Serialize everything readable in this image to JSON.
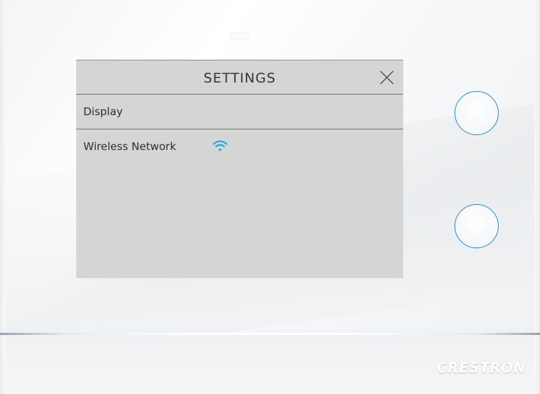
{
  "screen": {
    "title": "SETTINGS",
    "items": [
      {
        "label": "Display"
      },
      {
        "label": "Wireless Network",
        "status_icon": "wifi-icon"
      }
    ]
  },
  "hardware": {
    "brand": "CRESTRON",
    "up_button_icon": "chevron-up-icon",
    "down_button_icon": "chevron-down-icon",
    "accent_color": "#1e8fd0"
  }
}
